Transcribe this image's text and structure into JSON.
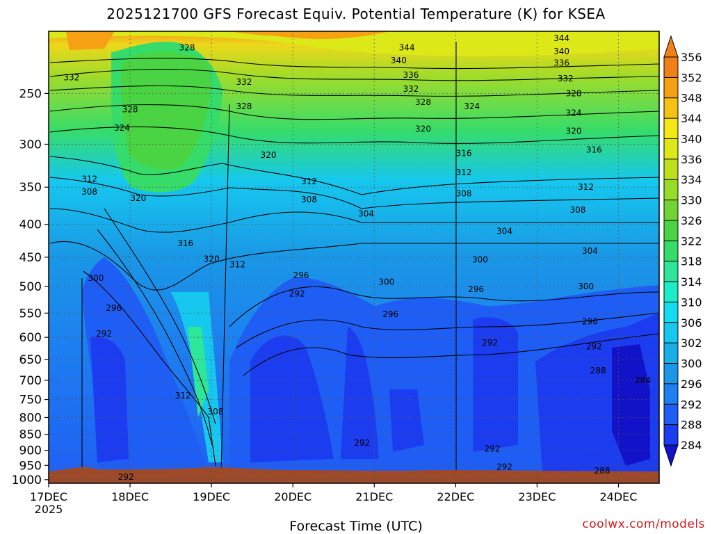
{
  "title": "2025121700 GFS Forecast Equiv. Potential Temperature (K) for KSEA",
  "xaxis_title": "Forecast Time (UTC)",
  "credit": "coolwx.com/models",
  "chart_data": {
    "type": "heatmap",
    "variable": "Equivalent potential temperature",
    "units": "K",
    "station": "KSEA",
    "init": "2025121700",
    "x_ticks": [
      "17DEC",
      "18DEC",
      "19DEC",
      "20DEC",
      "21DEC",
      "22DEC",
      "23DEC",
      "24DEC"
    ],
    "x_year_label": "2025",
    "x_range_days": [
      0,
      7.5
    ],
    "y_ticks": [
      250,
      300,
      350,
      400,
      450,
      500,
      550,
      600,
      650,
      700,
      750,
      800,
      850,
      900,
      950,
      1000
    ],
    "y_range_hpa": [
      200,
      1013
    ],
    "y_scale": "log pressure, inverted",
    "colorbar": {
      "levels": [
        284,
        288,
        292,
        296,
        300,
        302,
        306,
        310,
        314,
        318,
        322,
        326,
        330,
        334,
        336,
        340,
        344,
        348,
        352,
        356
      ],
      "colors": [
        "#1212c8",
        "#1c3cf0",
        "#1f5ef5",
        "#1d7ff0",
        "#1a97e6",
        "#19b0e8",
        "#16c8ee",
        "#14dcf0",
        "#1cecc8",
        "#2ee69a",
        "#36dc6a",
        "#4ad444",
        "#72d432",
        "#96dc28",
        "#bce01e",
        "#dce818",
        "#f4e814",
        "#f8c214",
        "#f6a014",
        "#f28018"
      ]
    },
    "contour_labels": [
      {
        "day": 0.28,
        "p": 236,
        "v": "332"
      },
      {
        "day": 1.0,
        "p": 265,
        "v": "328"
      },
      {
        "day": 0.9,
        "p": 283,
        "v": "324"
      },
      {
        "day": 1.7,
        "p": 212,
        "v": "328"
      },
      {
        "day": 0.5,
        "p": 340,
        "v": "312"
      },
      {
        "day": 0.5,
        "p": 356,
        "v": "308"
      },
      {
        "day": 1.1,
        "p": 364,
        "v": "320"
      },
      {
        "day": 1.68,
        "p": 428,
        "v": "316"
      },
      {
        "day": 2.0,
        "p": 453,
        "v": "320"
      },
      {
        "day": 2.32,
        "p": 462,
        "v": "312"
      },
      {
        "day": 0.58,
        "p": 485,
        "v": "300"
      },
      {
        "day": 0.8,
        "p": 540,
        "v": "296"
      },
      {
        "day": 0.68,
        "p": 592,
        "v": "292"
      },
      {
        "day": 1.65,
        "p": 740,
        "v": "312"
      },
      {
        "day": 2.05,
        "p": 783,
        "v": "308"
      },
      {
        "day": 0.95,
        "p": 990,
        "v": "292"
      },
      {
        "day": 2.4,
        "p": 240,
        "v": "332"
      },
      {
        "day": 2.4,
        "p": 262,
        "v": "328"
      },
      {
        "day": 2.7,
        "p": 312,
        "v": "320"
      },
      {
        "day": 3.2,
        "p": 343,
        "v": "312"
      },
      {
        "day": 3.2,
        "p": 366,
        "v": "308"
      },
      {
        "day": 3.9,
        "p": 385,
        "v": "304"
      },
      {
        "day": 3.1,
        "p": 480,
        "v": "296"
      },
      {
        "day": 3.05,
        "p": 513,
        "v": "292"
      },
      {
        "day": 4.15,
        "p": 492,
        "v": "300"
      },
      {
        "day": 4.2,
        "p": 552,
        "v": "296"
      },
      {
        "day": 3.85,
        "p": 876,
        "v": "292"
      },
      {
        "day": 4.4,
        "p": 212,
        "v": "344"
      },
      {
        "day": 4.3,
        "p": 222,
        "v": "340"
      },
      {
        "day": 4.45,
        "p": 234,
        "v": "336"
      },
      {
        "day": 4.45,
        "p": 246,
        "v": "332"
      },
      {
        "day": 4.6,
        "p": 258,
        "v": "328"
      },
      {
        "day": 5.2,
        "p": 262,
        "v": "324"
      },
      {
        "day": 4.6,
        "p": 284,
        "v": "320"
      },
      {
        "day": 5.1,
        "p": 310,
        "v": "316"
      },
      {
        "day": 5.1,
        "p": 332,
        "v": "312"
      },
      {
        "day": 5.1,
        "p": 358,
        "v": "308"
      },
      {
        "day": 5.6,
        "p": 410,
        "v": "304"
      },
      {
        "day": 5.3,
        "p": 454,
        "v": "300"
      },
      {
        "day": 5.25,
        "p": 505,
        "v": "296"
      },
      {
        "day": 5.42,
        "p": 612,
        "v": "292"
      },
      {
        "day": 5.45,
        "p": 895,
        "v": "292"
      },
      {
        "day": 5.6,
        "p": 955,
        "v": "292"
      },
      {
        "day": 6.3,
        "p": 205,
        "v": "344"
      },
      {
        "day": 6.3,
        "p": 215,
        "v": "340"
      },
      {
        "day": 6.3,
        "p": 224,
        "v": "336"
      },
      {
        "day": 6.35,
        "p": 237,
        "v": "332"
      },
      {
        "day": 6.45,
        "p": 250,
        "v": "328"
      },
      {
        "day": 6.45,
        "p": 268,
        "v": "324"
      },
      {
        "day": 6.45,
        "p": 286,
        "v": "320"
      },
      {
        "day": 6.7,
        "p": 306,
        "v": "316"
      },
      {
        "day": 6.6,
        "p": 350,
        "v": "312"
      },
      {
        "day": 6.5,
        "p": 380,
        "v": "308"
      },
      {
        "day": 6.65,
        "p": 440,
        "v": "304"
      },
      {
        "day": 6.6,
        "p": 500,
        "v": "300"
      },
      {
        "day": 6.65,
        "p": 567,
        "v": "296"
      },
      {
        "day": 6.7,
        "p": 620,
        "v": "292"
      },
      {
        "day": 6.75,
        "p": 676,
        "v": "288"
      },
      {
        "day": 7.3,
        "p": 700,
        "v": "284"
      },
      {
        "day": 6.8,
        "p": 968,
        "v": "288"
      }
    ]
  }
}
